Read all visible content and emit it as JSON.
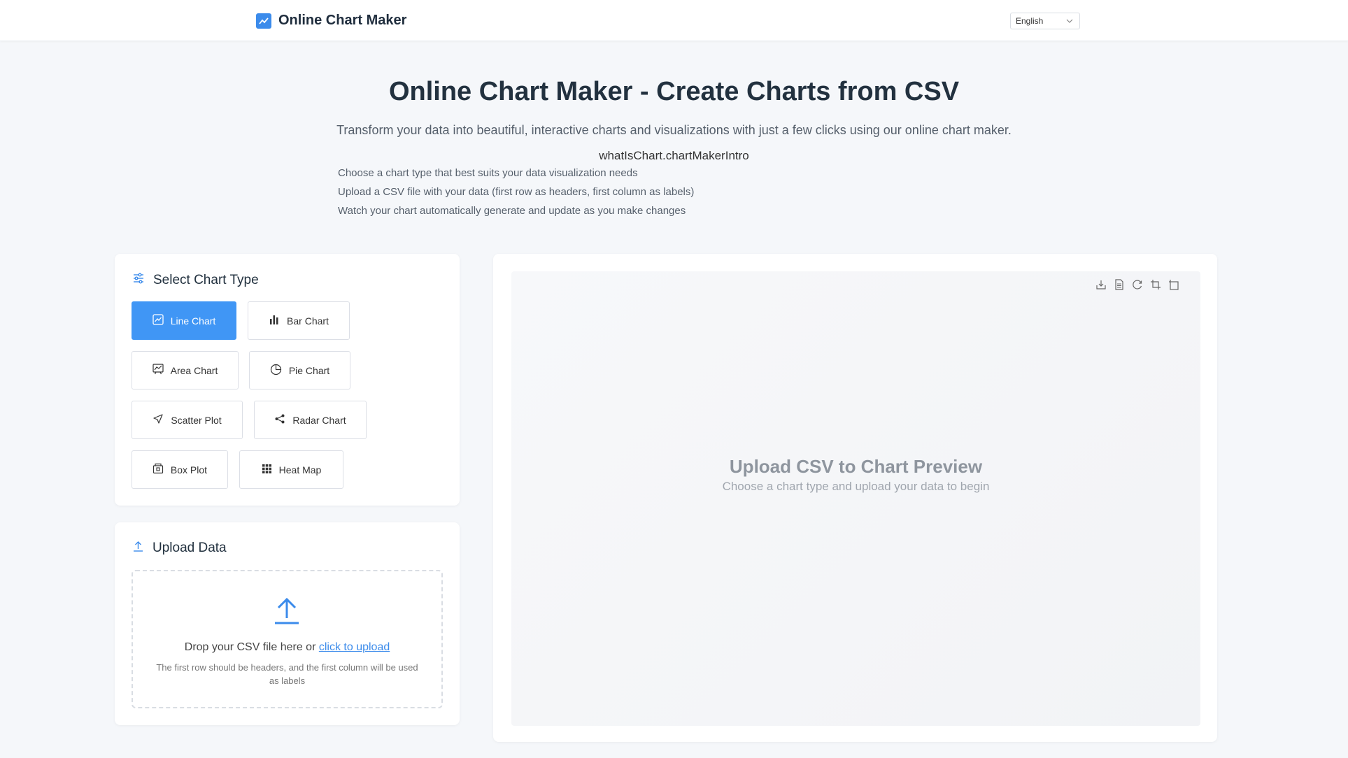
{
  "header": {
    "brand": "Online Chart Maker",
    "language": "English"
  },
  "hero": {
    "title": "Online Chart Maker - Create Charts from CSV",
    "subtitle": "Transform your data into beautiful, interactive charts and visualizations with just a few clicks using our online chart maker.",
    "intro_key": "whatIsChart.chartMakerIntro",
    "steps": [
      "Choose a chart type that best suits your data visualization needs",
      "Upload a CSV file with your data (first row as headers, first column as labels)",
      "Watch your chart automatically generate and update as you make changes"
    ]
  },
  "chart_type_panel": {
    "title": "Select Chart Type",
    "types": [
      {
        "label": "Line Chart",
        "icon": "line-chart-icon",
        "active": true
      },
      {
        "label": "Bar Chart",
        "icon": "bar-chart-icon",
        "active": false
      },
      {
        "label": "Area Chart",
        "icon": "area-chart-icon",
        "active": false
      },
      {
        "label": "Pie Chart",
        "icon": "pie-chart-icon",
        "active": false
      },
      {
        "label": "Scatter Plot",
        "icon": "scatter-icon",
        "active": false
      },
      {
        "label": "Radar Chart",
        "icon": "share-icon",
        "active": false
      },
      {
        "label": "Box Plot",
        "icon": "box-icon",
        "active": false
      },
      {
        "label": "Heat Map",
        "icon": "grid-icon",
        "active": false
      }
    ]
  },
  "upload_panel": {
    "title": "Upload Data",
    "drop_text": "Drop your CSV file here or ",
    "link_text": "click to upload",
    "hint": "The first row should be headers, and the first column will be used as labels"
  },
  "preview": {
    "title": "Upload CSV to Chart Preview",
    "subtitle": "Choose a chart type and upload your data to begin",
    "tools": [
      "download-icon",
      "document-icon",
      "refresh-icon",
      "crop-icon",
      "crop-alt-icon"
    ]
  },
  "colors": {
    "accent": "#4096f5",
    "brand_icon": "#3b8beb",
    "background": "#f5f7fa"
  }
}
